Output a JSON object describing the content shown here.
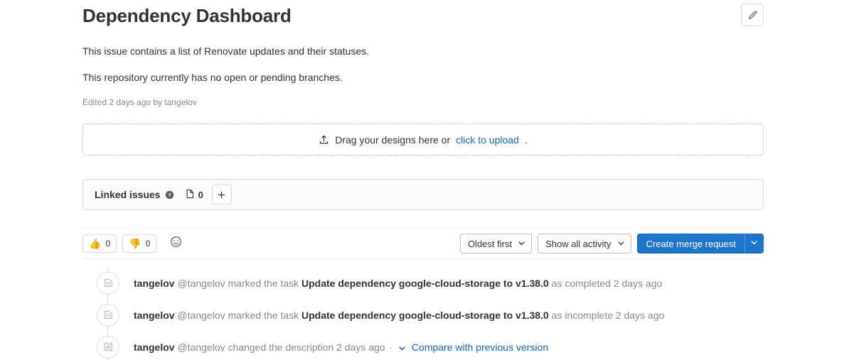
{
  "header": {
    "title": "Dependency Dashboard",
    "edit_icon": "pencil-icon"
  },
  "description": {
    "paragraph_1": "This issue contains a list of Renovate updates and their statuses.",
    "paragraph_2": "This repository currently has no open or pending branches.",
    "edited_note": "Edited 2 days ago by tangelov"
  },
  "dropzone": {
    "icon": "upload-icon",
    "text_before": "Drag your designs here or",
    "link_label": "click to upload",
    "text_after": "."
  },
  "linked_issues": {
    "title": "Linked issues",
    "help_icon": "question-circle-icon",
    "issue_icon": "issue-icon",
    "count": "0",
    "add_label": "+"
  },
  "toolbar": {
    "thumbs_up": {
      "emoji": "👍",
      "count": "0"
    },
    "thumbs_down": {
      "emoji": "👎",
      "count": "0"
    },
    "add_reaction_icon": "smiley-icon",
    "sort_label": "Oldest first",
    "filter_label": "Show all activity",
    "primary_label": "Create merge request",
    "primary_caret_icon": "chevron-down-icon",
    "accent_color": "#1f75cb",
    "link_color": "#1068bf"
  },
  "activity": [
    {
      "icon": "task-done-icon",
      "author": "tangelov",
      "handle": "@tangelov",
      "action": "marked the task",
      "task": "Update dependency google-cloud-storage to v1.38.0",
      "status": "as completed",
      "timestamp": "2 days ago"
    },
    {
      "icon": "task-done-icon",
      "author": "tangelov",
      "handle": "@tangelov",
      "action": "marked the task",
      "task": "Update dependency google-cloud-storage to v1.38.0",
      "status": "as incomplete",
      "timestamp": "2 days ago"
    },
    {
      "icon": "pencil-square-icon",
      "author": "tangelov",
      "handle": "@tangelov",
      "action": "changed the description",
      "task": "",
      "status": "",
      "timestamp": "2 days ago",
      "separator": "·",
      "compare_link": "Compare with previous version"
    }
  ]
}
